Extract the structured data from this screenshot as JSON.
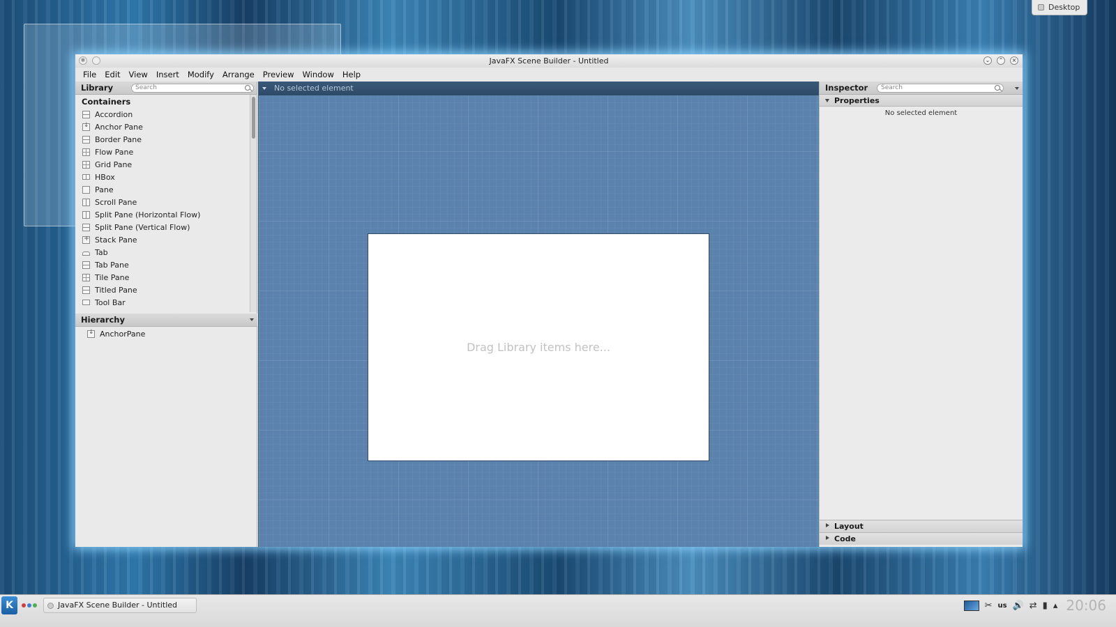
{
  "desktop": {
    "label": "Desktop"
  },
  "window": {
    "title": "JavaFX Scene Builder - Untitled"
  },
  "menu": [
    "File",
    "Edit",
    "View",
    "Insert",
    "Modify",
    "Arrange",
    "Preview",
    "Window",
    "Help"
  ],
  "library": {
    "title": "Library",
    "search_placeholder": "Search",
    "section": "Containers",
    "items": [
      {
        "label": "Accordion",
        "icon": "accordion-icon"
      },
      {
        "label": "Anchor Pane",
        "icon": "anchor-pane-icon"
      },
      {
        "label": "Border Pane",
        "icon": "border-pane-icon"
      },
      {
        "label": "Flow Pane",
        "icon": "flow-pane-icon"
      },
      {
        "label": "Grid Pane",
        "icon": "grid-pane-icon"
      },
      {
        "label": "HBox",
        "icon": "hbox-icon"
      },
      {
        "label": "Pane",
        "icon": "pane-icon"
      },
      {
        "label": "Scroll Pane",
        "icon": "scroll-pane-icon"
      },
      {
        "label": "Split Pane (Horizontal Flow)",
        "icon": "split-pane-horizontal-icon"
      },
      {
        "label": "Split Pane (Vertical Flow)",
        "icon": "split-pane-vertical-icon"
      },
      {
        "label": "Stack Pane",
        "icon": "stack-pane-icon"
      },
      {
        "label": "Tab",
        "icon": "tab-icon"
      },
      {
        "label": "Tab Pane",
        "icon": "tab-pane-icon"
      },
      {
        "label": "Tile Pane",
        "icon": "tile-pane-icon"
      },
      {
        "label": "Titled Pane",
        "icon": "titled-pane-icon"
      },
      {
        "label": "Tool Bar",
        "icon": "tool-bar-icon"
      }
    ]
  },
  "hierarchy": {
    "title": "Hierarchy",
    "items": [
      {
        "label": "AnchorPane",
        "icon": "anchor-pane-icon"
      }
    ]
  },
  "canvas": {
    "selection_label": "No selected element",
    "drop_hint": "Drag Library items here..."
  },
  "inspector": {
    "title": "Inspector",
    "search_placeholder": "Search",
    "properties_title": "Properties",
    "properties_empty": "No selected element",
    "layout_title": "Layout",
    "code_title": "Code"
  },
  "taskbar": {
    "task_label": "JavaFX Scene Builder - Untitled",
    "keyboard_layout": "us",
    "clock": "20:06"
  }
}
